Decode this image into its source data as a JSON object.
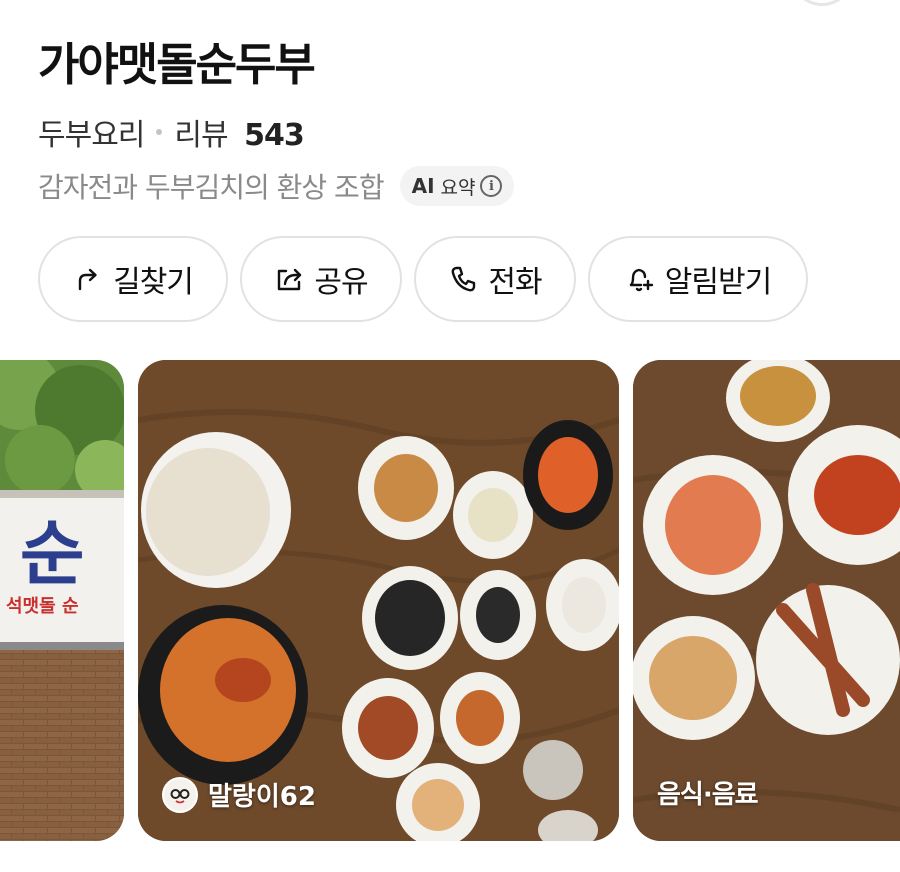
{
  "place": {
    "name": "가야맷돌순두부",
    "category": "두부요리",
    "review_label": "리뷰",
    "review_count": "543",
    "summary": "감자전과 두부김치의 환상 조합",
    "ai_badge": {
      "ai": "AI",
      "label": "요약",
      "info": "i"
    }
  },
  "actions": [
    {
      "label": "길찾기",
      "icon": "directions-icon"
    },
    {
      "label": "공유",
      "icon": "share-icon"
    },
    {
      "label": "전화",
      "icon": "phone-icon"
    },
    {
      "label": "알림받기",
      "icon": "bell-plus-icon"
    }
  ],
  "photos": {
    "storefront": {
      "sign_big": "순",
      "sign_small": "석맷돌 순"
    },
    "meal": {
      "author": "말랑이62"
    },
    "food": {
      "category": "음식·음료"
    }
  },
  "colors": {
    "border": "#e2e2e2",
    "muted": "#8a8a8a",
    "chip_bg": "#f3f3f3",
    "wood": "#6e4a2b"
  }
}
